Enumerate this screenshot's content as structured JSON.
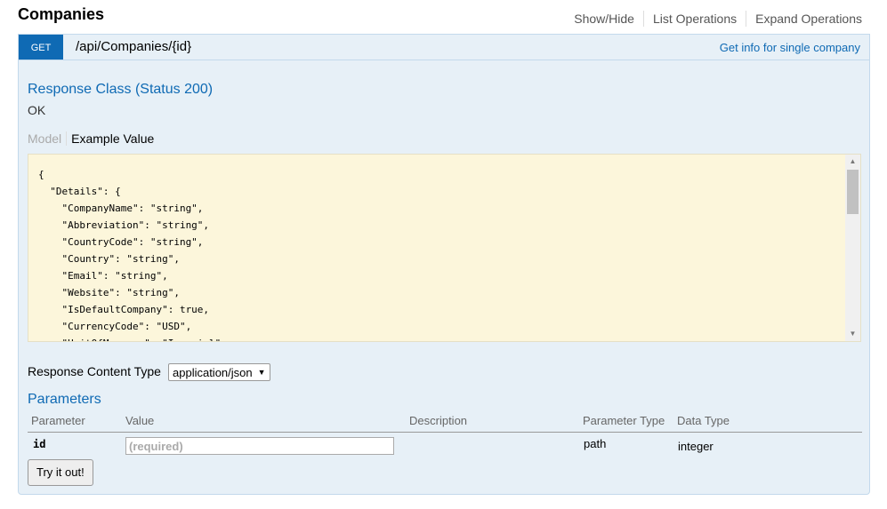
{
  "resource": {
    "title": "Companies",
    "links": [
      "Show/Hide",
      "List Operations",
      "Expand Operations"
    ]
  },
  "operation": {
    "method": "GET",
    "path": "/api/Companies/{id}",
    "summary": "Get info for single company"
  },
  "response_class": {
    "heading": "Response Class (Status 200)",
    "status_text": "OK",
    "tabs": {
      "model": "Model",
      "example": "Example Value"
    },
    "example_lines": [
      "{",
      "  \"Details\": {",
      "    \"CompanyName\": \"string\",",
      "    \"Abbreviation\": \"string\",",
      "    \"CountryCode\": \"string\",",
      "    \"Country\": \"string\",",
      "    \"Email\": \"string\",",
      "    \"Website\": \"string\",",
      "    \"IsDefaultCompany\": true,",
      "    \"CurrencyCode\": \"USD\",",
      "    \"UnitOfMeasure\": \"Imperial\","
    ]
  },
  "response_content_type": {
    "label": "Response Content Type",
    "selected": "application/json"
  },
  "parameters": {
    "heading": "Parameters",
    "columns": [
      "Parameter",
      "Value",
      "Description",
      "Parameter Type",
      "Data Type"
    ],
    "rows": [
      {
        "name": "id",
        "placeholder": "(required)",
        "description": "",
        "param_type": "path",
        "data_type": "integer"
      }
    ]
  },
  "try_button": "Try it out!",
  "colors": {
    "get_method": "#0f6ab4",
    "panel_bg": "#e7f0f7",
    "code_bg": "#fcf6db",
    "link_blue": "#0f6ab4"
  }
}
